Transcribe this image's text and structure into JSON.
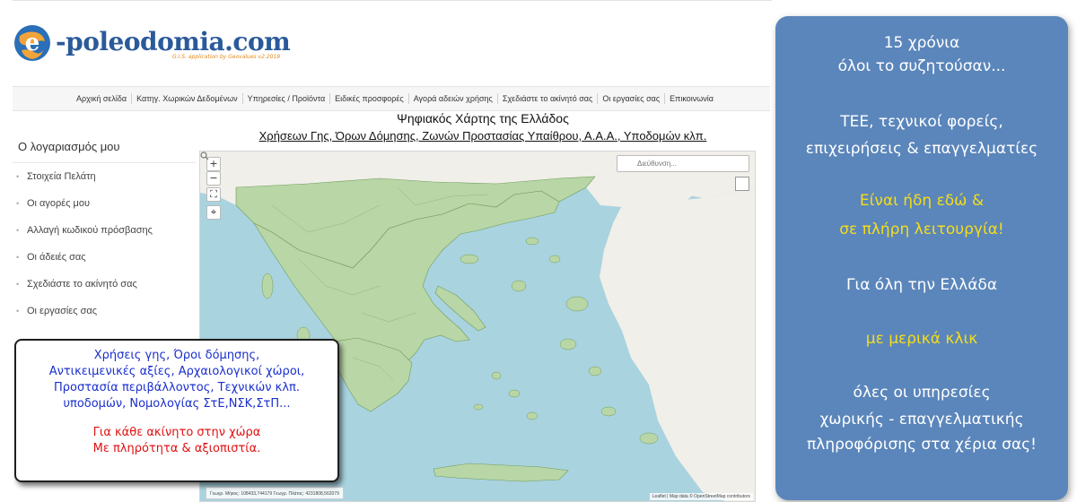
{
  "logo": {
    "text": "-poleodomia.com",
    "subtitle": "G.I.S. application by Geovalues v2.2019",
    "letter": "e"
  },
  "nav": {
    "items": [
      "Αρχική σελίδα",
      "Κατηγ. Χωρικών Δεδομένων",
      "Υπηρεσίες / Προϊόντα",
      "Ειδικές προσφορές",
      "Αγορά αδειών χρήσης",
      "Σχεδιάστε το ακίνητό σας",
      "Οι εργασίες σας",
      "Επικοινωνία"
    ]
  },
  "account": {
    "title": "Ο λογαριασμός μου",
    "items": [
      "Στοιχεία Πελάτη",
      "Οι αγορές μου",
      "Αλλαγή κωδικού πρόσβασης",
      "Οι άδειές σας",
      "Σχεδιάστε το ακίνητό σας",
      "Οι εργασίες σας"
    ]
  },
  "map": {
    "title": "Ψηφιακός Χάρτης της Ελλάδος",
    "subtitle": "Χρήσεων Γης, Όρων Δόμησης, Ζωνών Προστασίας Υπαίθρου, Α.Α.Α., Υποδομών κλπ.",
    "search_placeholder": "Διεύθυνση...",
    "zoom_in": "+",
    "zoom_out": "−",
    "coordinates": "Γεωγρ. Μήκος: 108433,744179 Γεωγρ. Πλάτος: 4231808,562079",
    "attribution": "Leaflet | Map data © OpenStreetMap contributors",
    "colors": {
      "sea": "#a9d3df",
      "land": "#f1efe9",
      "zones": "#b9d6a6",
      "zone_border": "#6f9c5b"
    }
  },
  "info_box": {
    "lines": [
      "Χρήσεις γης, Όροι δόμησης,",
      "Αντικειμενικές αξίες, Αρχαιολογικοί χώροι,",
      "Προστασία περιβάλλοντος, Τεχνικών κλπ.",
      "υποδομών, Νομολογίας ΣτΕ,ΝΣΚ,ΣτΠ..."
    ],
    "red_lines": [
      "Για κάθε ακίνητο στην χώρα",
      "Με πληρότητα & αξιοπιστία."
    ],
    "colors": {
      "blue_text": "#1a2fcc",
      "red_text": "#e01010"
    }
  },
  "promo": {
    "line1": "15 χρόνια",
    "line2": "όλοι το συζητούσαν...",
    "line3": "ΤΕΕ, τεχνικοί φορείς,",
    "line4": "επιχειρήσεις & επαγγελματίες",
    "line5": "Είναι ήδη εδώ &",
    "line6": "σε πλήρη λειτουργία!",
    "line7": "Για όλη την Ελλάδα",
    "line8": "με μερικά κλικ",
    "line9": "όλες οι υπηρεσίες",
    "line10": "χωρικής - επαγγελματικής",
    "line11": "πληροφόρισης στα χέρια σας!",
    "colors": {
      "panel": "#5b86bb",
      "highlight": "#f5dd1a"
    }
  }
}
